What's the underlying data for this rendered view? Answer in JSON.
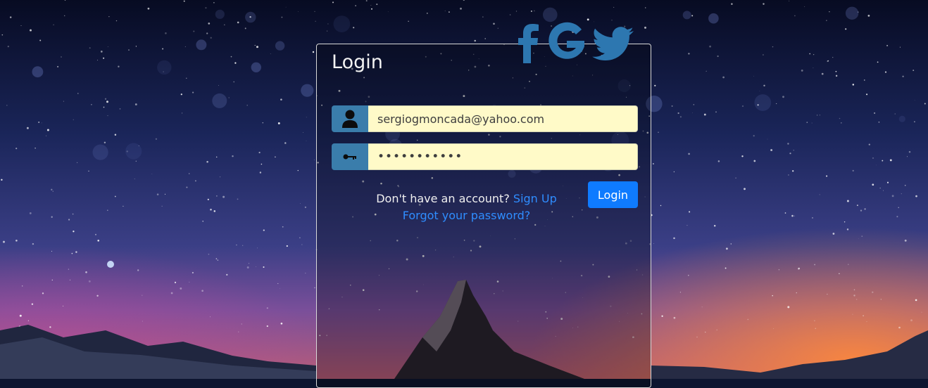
{
  "login": {
    "title": "Login",
    "email_value": "sergiogmoncada@yahoo.com",
    "password_value": "sergiopass1",
    "login_button": "Login",
    "signup_prompt": "Don't have an account?",
    "signup_link": "Sign Up",
    "forgot_link": "Forgot your password?"
  },
  "social": [
    "facebook-icon",
    "google-icon",
    "twitter-icon"
  ],
  "colors": {
    "social": "#2d77b0",
    "addon": "#3a7dab",
    "field_bg": "#fffac8",
    "button": "#0f7bff",
    "link": "#2f8dff"
  }
}
